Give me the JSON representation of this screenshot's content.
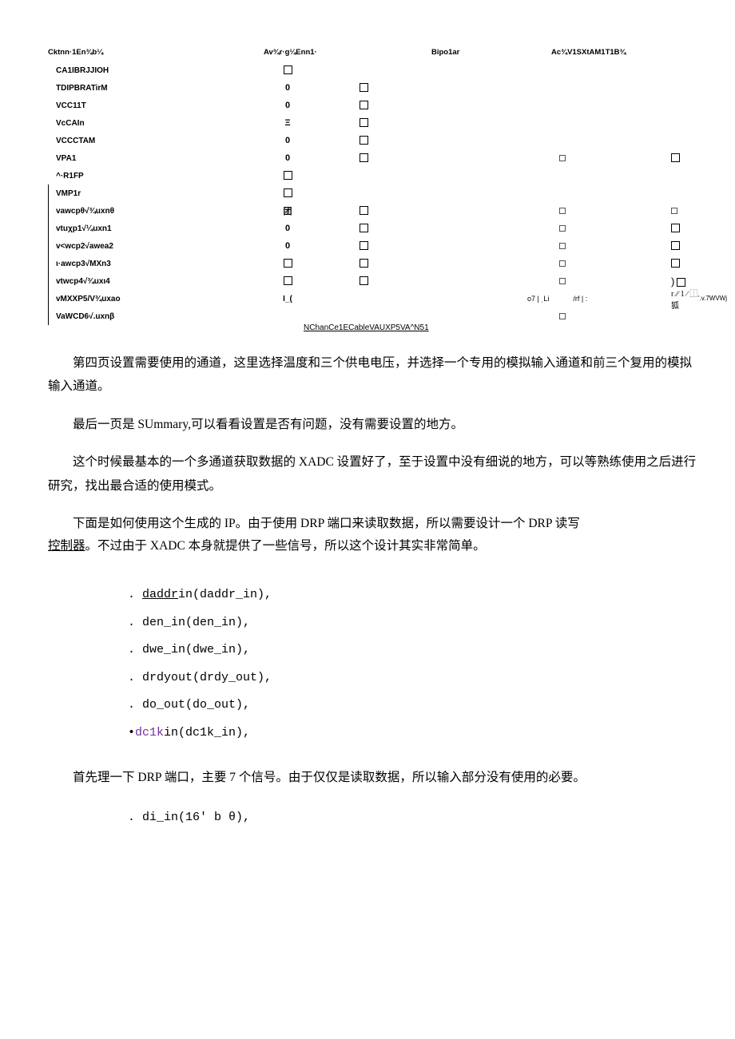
{
  "header": {
    "colA": "Cktnn·1En¾b¼",
    "colB": "Av¾r·g¼Enn1·",
    "colC": "Bipo1ar",
    "colD": "Ac¾V1SXtAM1T1B¾"
  },
  "rows": [
    {
      "label": "CA1IBRJJIOH",
      "en": "cb",
      "avg": "",
      "bip": "",
      "acq": ""
    },
    {
      "label": "TDIPBRATirM",
      "en": "0",
      "avg": "cb",
      "bip": "",
      "acq": ""
    },
    {
      "label": "VCC11T",
      "en": "0",
      "avg": "cb",
      "bip": "",
      "acq": ""
    },
    {
      "label": "VcCAIn",
      "en": "Ξ",
      "avg": "cb",
      "bip": "",
      "acq": ""
    },
    {
      "label": "VCCCTAM",
      "en": "0",
      "avg": "cb",
      "bip": "",
      "acq": ""
    },
    {
      "label": "VPA1",
      "en": "0",
      "avg": "cb",
      "bip": "small",
      "acq": "cb"
    },
    {
      "label": "^·R1FP",
      "en": "cb",
      "avg": "",
      "bip": "",
      "acq": ""
    },
    {
      "label": "VMP1r",
      "en": "cb",
      "avg": "",
      "bip": "",
      "acq": ""
    },
    {
      "label": "vawcpθ√¾uxnθ",
      "en": "团",
      "avg": "cb",
      "bip": "small",
      "acq": "small"
    },
    {
      "label": "vtuχp1√¼uxn1",
      "en": "0",
      "avg": "cb",
      "bip": "small",
      "acq": "cb"
    },
    {
      "label": "v<wcp2√awea2",
      "en": "0b",
      "avg": "cb",
      "bip": "small",
      "acq": "cb"
    },
    {
      "label": "ι·awcp3√MXn3",
      "en": "cb",
      "avg": "cb",
      "bip": "small",
      "acq": "cb"
    },
    {
      "label": "vtwcp4√¾uxι4",
      "en": "cb",
      "avg": "cb",
      "bip": "small",
      "acq": "paren-cb"
    },
    {
      "label": "vMXXP5/V¾uxao",
      "en": "I_(",
      "avg": "sp",
      "bip": "sp2",
      "acq": "sp3"
    },
    {
      "label": "VaWCD6√.uxnβ",
      "en": "",
      "avg": "",
      "bip": "small",
      "acq": ""
    }
  ],
  "note_under": "NChanCe1ECableVAUXP5VA^N51",
  "special_row": {
    "avg": "",
    "bip_text": "о7 | ˌLi",
    "rf": "/rf | :",
    "acq_text": "r ∕∕ 1 ∕ ⿰狐",
    "acq_sub": "'.v.7WVWj"
  },
  "body": {
    "p1": "第四页设置需要使用的通道，这里选择温度和三个供电电压，并选择一个专用的模拟输入通道和前三个复用的模拟输入通道。",
    "p2": "最后一页是 SUmmary,可以看看设置是否有问题，没有需要设置的地方。",
    "p3": "这个时候最基本的一个多通道获取数据的 XADC 设置好了，至于设置中没有细说的地方，可以等熟练使用之后进行研究，找出最合适的使用模式。",
    "p4a": "下面是如何使用这个生成的 IP。由于使用 DRP 端口来读取数据，所以需要设计一个 DRP 读写",
    "p4b_link": "控制器",
    "p4c": "。不过由于 XADC 本身就提供了一些信号，所以这个设计其实非常简单。",
    "p5": "首先理一下 DRP 端口，主要 7 个信号。由于仅仅是读取数据，所以输入部分没有使用的必要。"
  },
  "code1": {
    "l1a": ". ",
    "l1_daddr": "daddr",
    "l1b": "in(daddr_in),",
    "l2": ". den_in(den_in),",
    "l3": ". dwe_in(dwe_in),",
    "l4": ". drdyout(drdy_out),",
    "l5": ". do_out(do_out),",
    "l6a": "•",
    "l6_dclk": "dc1k",
    "l6b": "in(dc1k_in),"
  },
  "code2": {
    "l1": ". di_in(16' b θ),"
  }
}
